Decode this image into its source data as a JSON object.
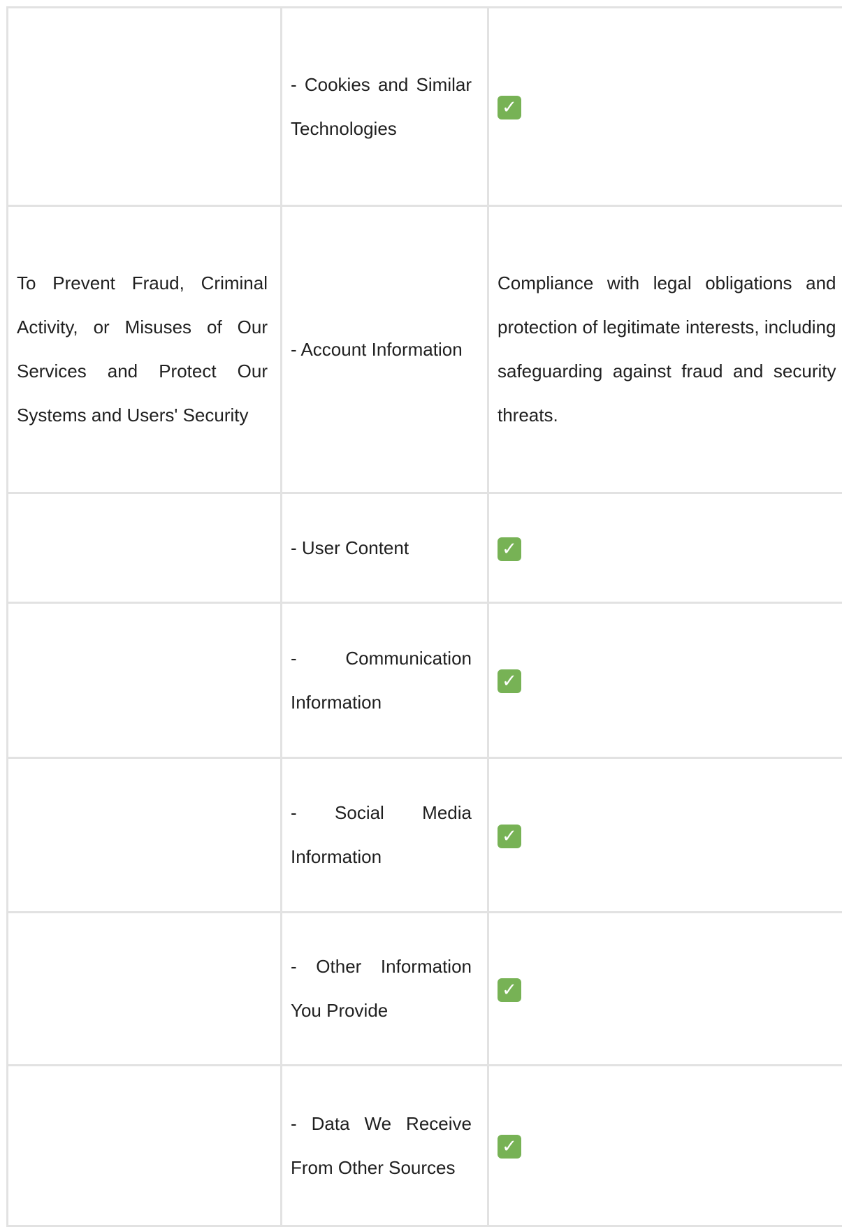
{
  "table": {
    "rows": [
      {
        "purpose": "",
        "category": "- Cookies and Similar Technologies",
        "basis": "",
        "check_icon": "white-heavy-check-mark-green-box"
      },
      {
        "purpose": "To Prevent Fraud, Criminal Activity, or Misuses of Our Services and Protect Our Systems and Users' Security",
        "category": "- Account Information",
        "basis": "Compliance with legal obligations and protection of legitimate interests, including safeguarding against fraud and security threats.",
        "check_icon": ""
      },
      {
        "purpose": "",
        "category": "- User Content",
        "basis": "",
        "check_icon": "white-heavy-check-mark-green-box"
      },
      {
        "purpose": "",
        "category": "- Communication Information",
        "basis": "",
        "check_icon": "white-heavy-check-mark-green-box"
      },
      {
        "purpose": "",
        "category": "- Social Media Information",
        "basis": "",
        "check_icon": "white-heavy-check-mark-green-box"
      },
      {
        "purpose": "",
        "category": "- Other Information You Provide",
        "basis": "",
        "check_icon": "white-heavy-check-mark-green-box"
      },
      {
        "purpose": "",
        "category": "- Data We Receive From Other Sources",
        "basis": "",
        "check_icon": "white-heavy-check-mark-green-box"
      }
    ]
  },
  "colors": {
    "border": "#e2e2e2",
    "text": "#1f1f1f",
    "check_bg": "#77b255",
    "check_fg": "#ffffff"
  }
}
